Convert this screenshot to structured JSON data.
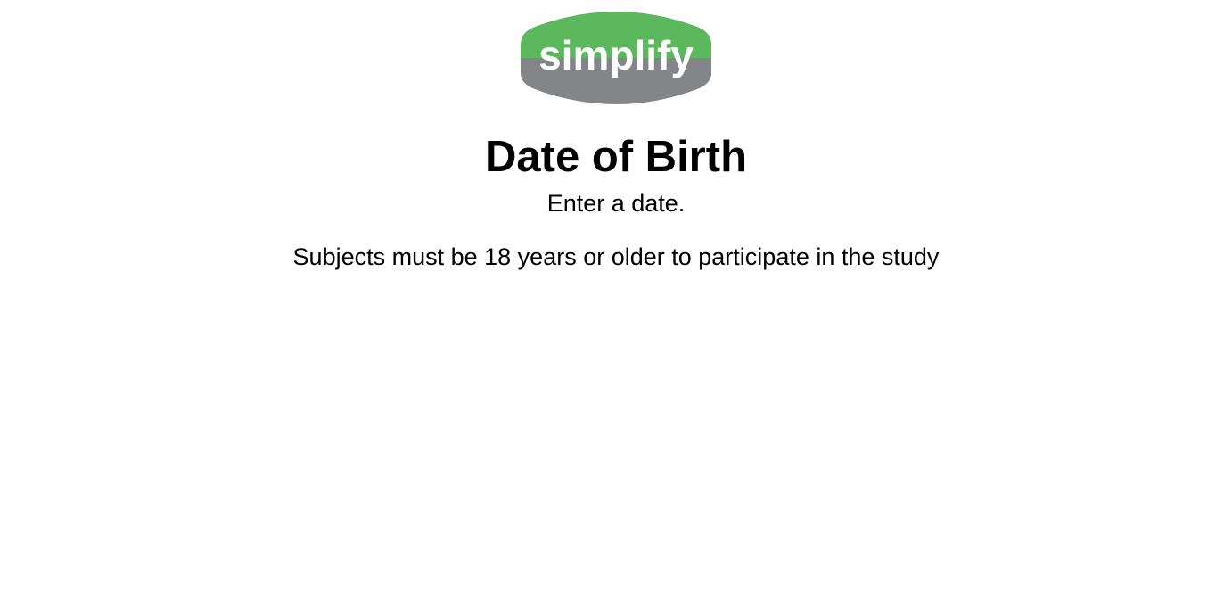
{
  "logo": {
    "text": "simplify",
    "colors": {
      "top": "#5cb85c",
      "bottom": "#848589",
      "text": "#ffffff"
    }
  },
  "heading": {
    "title": "Date of Birth",
    "subtitle": "Enter a date.",
    "note": "Subjects must be 18 years or older to participate in the study"
  }
}
